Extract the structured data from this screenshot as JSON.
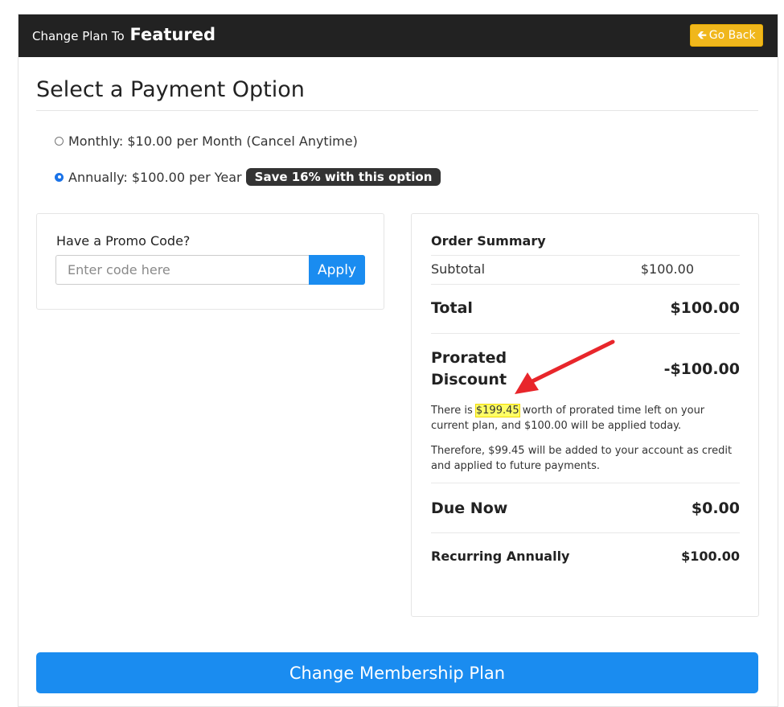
{
  "header": {
    "prefix": "Change Plan To",
    "plan_name": "Featured",
    "go_back_label": "Go Back"
  },
  "page_title": "Select a Payment Option",
  "options": {
    "monthly": "Monthly: $10.00 per Month (Cancel Anytime)",
    "annually": "Annually: $100.00 per Year",
    "badge": "Save 16% with this option",
    "selected": "annually"
  },
  "promo": {
    "label": "Have a Promo Code?",
    "placeholder": "Enter code here",
    "value": "",
    "apply_label": "Apply"
  },
  "summary": {
    "heading": "Order Summary",
    "subtotal_label": "Subtotal",
    "subtotal_value": "$100.00",
    "total_label": "Total",
    "total_value": "$100.00",
    "prorated_label_1": "Prorated",
    "prorated_label_2": "Discount",
    "prorated_value": "-$100.00",
    "note1_pre": "There is ",
    "note1_amount": "$199.45",
    "note1_post": " worth of prorated time left on your current plan, and $100.00 will be applied today.",
    "note2": "Therefore, $99.45 will be added to your account as credit and applied to future payments.",
    "due_label": "Due Now",
    "due_value": "$0.00",
    "recurring_label": "Recurring Annually",
    "recurring_value": "$100.00"
  },
  "submit_label": "Change Membership Plan",
  "colors": {
    "header_bg": "#222222",
    "go_back": "#f0b71c",
    "primary": "#1a8cf0",
    "annotation_arrow": "#e8262b",
    "highlight": "#ffff66"
  },
  "icons": {
    "go_back": "arrow-left-icon",
    "annotation": "red-arrow-annotation"
  }
}
